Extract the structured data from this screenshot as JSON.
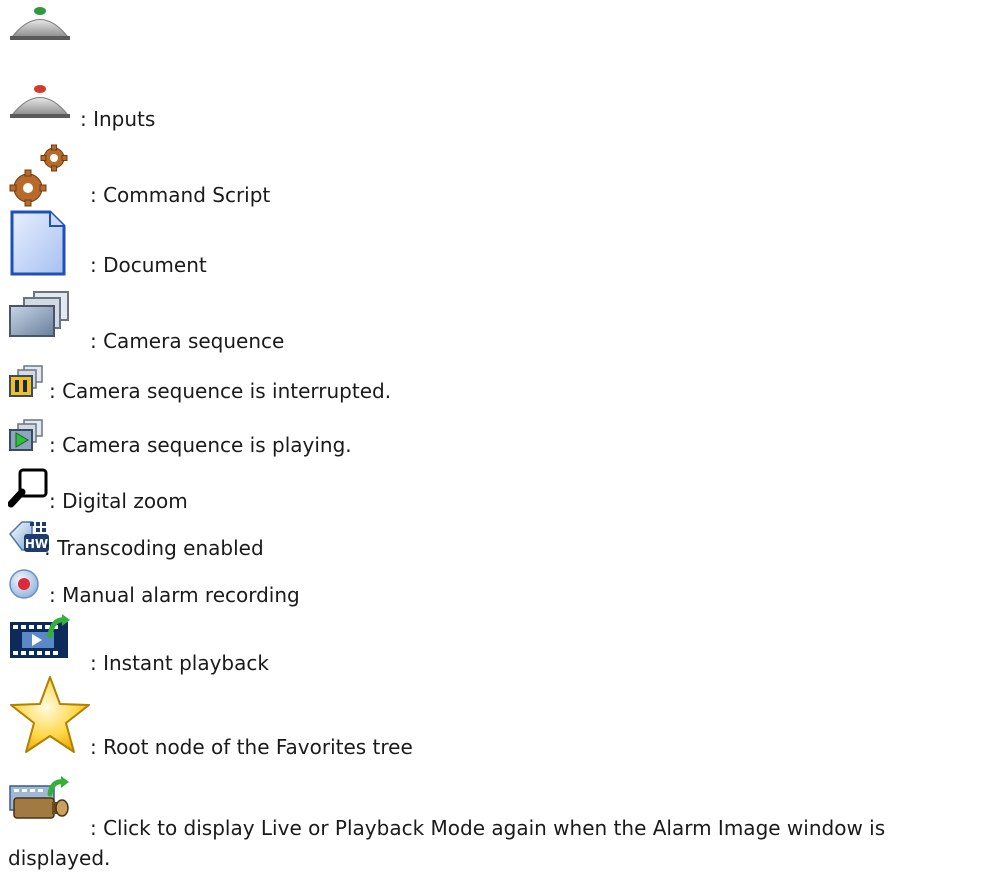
{
  "legend": [
    {
      "icon": "alarm-button-green-icon",
      "text": ""
    },
    {
      "icon": "alarm-button-red-icon",
      "text": ": Inputs"
    },
    {
      "icon": "gears-icon",
      "text": ": Command Script"
    },
    {
      "icon": "document-icon",
      "text": ": Document"
    },
    {
      "icon": "camera-sequence-icon",
      "text": ": Camera sequence"
    },
    {
      "icon": "camera-sequence-paused-icon",
      "text": ": Camera sequence is interrupted."
    },
    {
      "icon": "camera-sequence-playing-icon",
      "text": ": Camera sequence is playing."
    },
    {
      "icon": "magnifier-icon",
      "text": ": Digital zoom"
    },
    {
      "icon": "transcoding-hw-icon",
      "text": ": Transcoding enabled"
    },
    {
      "icon": "record-icon",
      "text": ": Manual alarm recording"
    },
    {
      "icon": "instant-playback-icon",
      "text": ": Instant playback"
    },
    {
      "icon": "star-icon",
      "text": ": Root node of the Favorites tree"
    },
    {
      "icon": "live-playback-camera-icon",
      "text": ": Click to display Live or Playback Mode again when the Alarm Image window is displayed."
    }
  ]
}
